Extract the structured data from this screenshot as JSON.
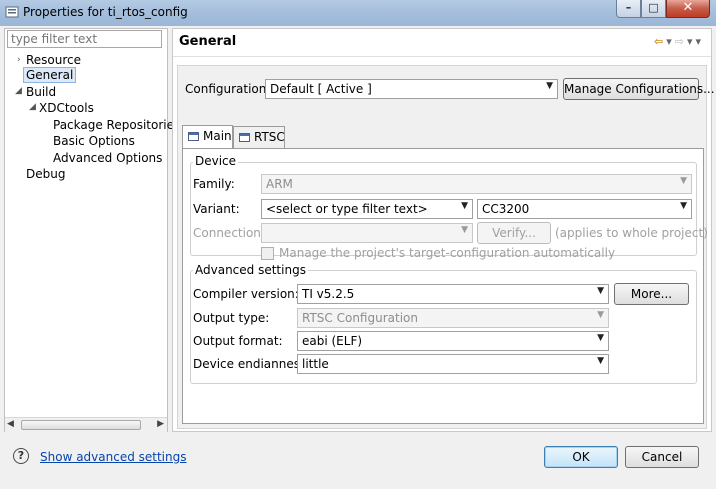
{
  "window": {
    "title": "Properties for ti_rtos_config",
    "minimize": "–",
    "maximize": "□",
    "close": "✕"
  },
  "sidebar": {
    "filter_placeholder": "type filter text",
    "items": [
      {
        "label": "Resource"
      },
      {
        "label": "General"
      },
      {
        "label": "Build"
      },
      {
        "label": "XDCtools"
      },
      {
        "label": "Package Repositories"
      },
      {
        "label": "Basic Options"
      },
      {
        "label": "Advanced Options"
      },
      {
        "label": "Debug"
      }
    ]
  },
  "page": {
    "title": "General",
    "configuration_label": "Configuration:",
    "configuration_value": "Default  [ Active ]",
    "manage_button": "Manage Configurations...",
    "tabs": [
      {
        "label": "Main"
      },
      {
        "label": "RTSC"
      }
    ],
    "device": {
      "group_title": "Device",
      "family_label": "Family:",
      "family_value": "ARM",
      "variant_label": "Variant:",
      "variant_filter": "<select or type filter text>",
      "variant_value": "CC3200",
      "connection_label": "Connection:",
      "verify_button": "Verify...",
      "applies_note": "(applies to whole project)",
      "manage_checkbox": "Manage the project's target-configuration automatically"
    },
    "advanced": {
      "group_title": "Advanced settings",
      "compiler_label": "Compiler version:",
      "compiler_value": "TI v5.2.5",
      "more_button": "More...",
      "output_type_label": "Output type:",
      "output_type_value": "RTSC Configuration",
      "output_format_label": "Output format:",
      "output_format_value": "eabi (ELF)",
      "endianness_label": "Device endianness:",
      "endianness_value": "little"
    }
  },
  "footer": {
    "help_icon": "?",
    "advanced_link": "Show advanced settings",
    "ok_button": "OK",
    "cancel_button": "Cancel"
  },
  "icons": [
    "app-icon",
    "back-arrow-icon",
    "forward-arrow-icon",
    "menu-chevron-icon",
    "tab-icon",
    "help-icon"
  ]
}
